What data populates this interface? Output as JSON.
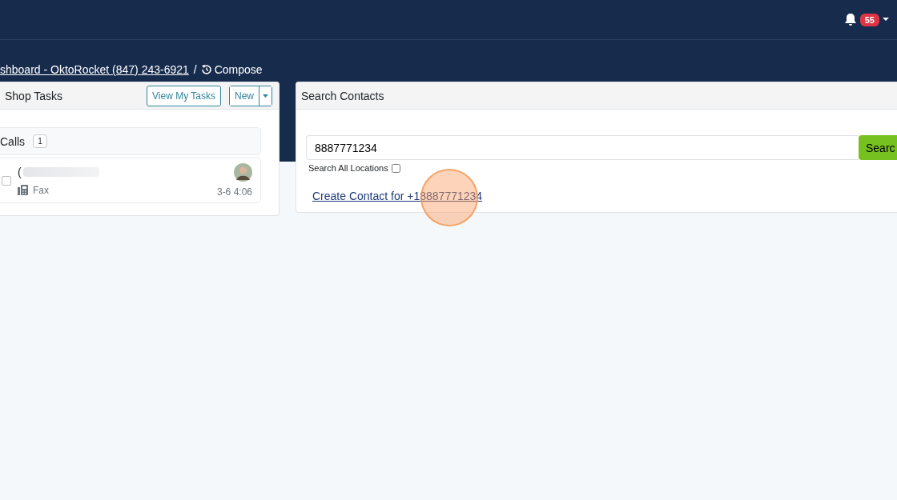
{
  "navbar": {
    "notification_count": "55"
  },
  "breadcrumb": {
    "link": "shboard - OktoRocket (847) 243-6921",
    "separator": "/",
    "current": "Compose"
  },
  "tasks_panel": {
    "title": "Shop Tasks",
    "buttons": [
      "View My Tasks",
      "New"
    ],
    "group": {
      "title": "Calls",
      "count": "1"
    },
    "items": [
      {
        "name": "(",
        "type": "Fax",
        "time": "3-6 4:06",
        "checked": false
      }
    ]
  },
  "search_panel": {
    "title": "Search Contacts",
    "query": "8887771234",
    "button": "Searc",
    "all_locations_label": "Search All Locations",
    "all_locations_checked": false,
    "create_link": "Create Contact for +18887771234"
  }
}
